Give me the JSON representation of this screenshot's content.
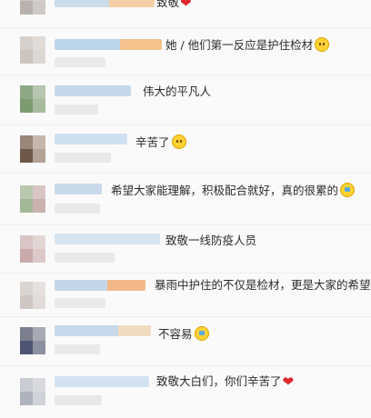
{
  "comments": [
    {
      "text": "致敬",
      "emoji": "heart",
      "emoji_glyph": "❤"
    },
    {
      "text": "她 / 他们第一反应是护住检材",
      "emoji": "worried-face",
      "emoji_glyph": ""
    },
    {
      "text": "伟大的平凡人",
      "emoji": "",
      "emoji_glyph": ""
    },
    {
      "text": "辛苦了",
      "emoji": "worried-face",
      "emoji_glyph": ""
    },
    {
      "text": "希望大家能理解，积极配合就好，真的很累的",
      "emoji": "crying-face",
      "emoji_glyph": ""
    },
    {
      "text": "致敬一线防疫人员",
      "emoji": "",
      "emoji_glyph": ""
    },
    {
      "text": "暴雨中护住的不仅是检材，更是大家的希望，",
      "emoji": "",
      "emoji_glyph": ""
    },
    {
      "text": "不容易",
      "emoji": "crying-face",
      "emoji_glyph": ""
    },
    {
      "text": "致敬大白们，你们辛苦了",
      "emoji": "heart",
      "emoji_glyph": "❤"
    }
  ],
  "colors": {
    "background": "#fafafa",
    "text": "#2b2b2b",
    "heart": "#e0262b",
    "emoji_yellow": "#ffd233"
  }
}
